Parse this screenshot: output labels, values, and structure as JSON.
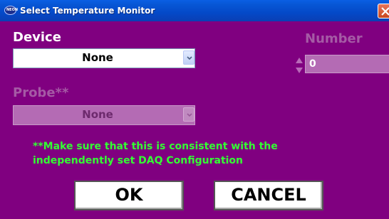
{
  "window": {
    "title": "Select Temperature Monitor",
    "icon_text": "NEON",
    "background": "#800080",
    "titlebar_color": "#0757d6"
  },
  "device": {
    "label": "Device",
    "selected": "None"
  },
  "number": {
    "label": "Number",
    "value": "0",
    "enabled": false
  },
  "probe": {
    "label": "Probe**",
    "selected": "None",
    "enabled": false
  },
  "note": {
    "line1": "**Make sure that this is consistent with the",
    "line2": "independently set DAQ Configuration",
    "color": "#33ff33"
  },
  "buttons": {
    "ok": "OK",
    "cancel": "CANCEL"
  }
}
